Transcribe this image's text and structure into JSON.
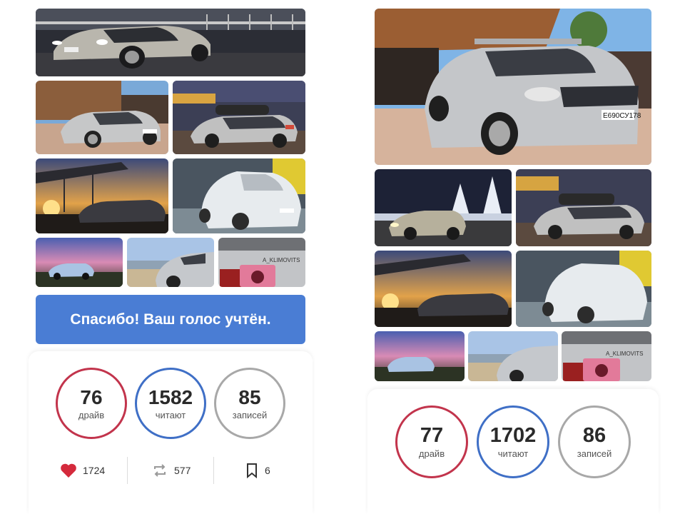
{
  "left": {
    "vote_message": "Спасибо! Ваш голос учтён.",
    "stats": [
      {
        "value": "76",
        "label": "драйв",
        "color": "#c2344c"
      },
      {
        "value": "1582",
        "label": "читают",
        "color": "#3f6fc6"
      },
      {
        "value": "85",
        "label": "записей",
        "color": "#a8a8a8"
      }
    ],
    "actions": {
      "likes": "1724",
      "reposts": "577",
      "bookmarks": "6"
    }
  },
  "right": {
    "stats": [
      {
        "value": "77",
        "label": "драйв",
        "color": "#c2344c"
      },
      {
        "value": "1702",
        "label": "читают",
        "color": "#3f6fc6"
      },
      {
        "value": "86",
        "label": "записей",
        "color": "#a8a8a8"
      }
    ]
  },
  "photos": {
    "plate_1": "Е690СУ178",
    "sticker_text": "A_KLIMOVITS"
  },
  "icons": {
    "like": "heart-icon",
    "repost": "repost-icon",
    "bookmark": "bookmark-icon"
  },
  "colors": {
    "accent_blue": "#4a7dd4",
    "heart_red": "#d42a3c"
  }
}
